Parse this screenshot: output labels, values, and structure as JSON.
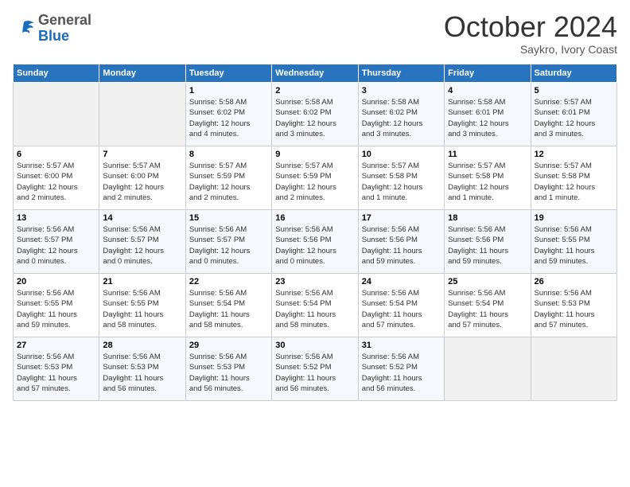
{
  "header": {
    "logo": {
      "general": "General",
      "blue": "Blue"
    },
    "title": "October 2024",
    "location": "Saykro, Ivory Coast"
  },
  "calendar": {
    "days_of_week": [
      "Sunday",
      "Monday",
      "Tuesday",
      "Wednesday",
      "Thursday",
      "Friday",
      "Saturday"
    ],
    "weeks": [
      [
        {
          "day": "",
          "info": ""
        },
        {
          "day": "",
          "info": ""
        },
        {
          "day": "1",
          "info": "Sunrise: 5:58 AM\nSunset: 6:02 PM\nDaylight: 12 hours\nand 4 minutes."
        },
        {
          "day": "2",
          "info": "Sunrise: 5:58 AM\nSunset: 6:02 PM\nDaylight: 12 hours\nand 3 minutes."
        },
        {
          "day": "3",
          "info": "Sunrise: 5:58 AM\nSunset: 6:02 PM\nDaylight: 12 hours\nand 3 minutes."
        },
        {
          "day": "4",
          "info": "Sunrise: 5:58 AM\nSunset: 6:01 PM\nDaylight: 12 hours\nand 3 minutes."
        },
        {
          "day": "5",
          "info": "Sunrise: 5:57 AM\nSunset: 6:01 PM\nDaylight: 12 hours\nand 3 minutes."
        }
      ],
      [
        {
          "day": "6",
          "info": "Sunrise: 5:57 AM\nSunset: 6:00 PM\nDaylight: 12 hours\nand 2 minutes."
        },
        {
          "day": "7",
          "info": "Sunrise: 5:57 AM\nSunset: 6:00 PM\nDaylight: 12 hours\nand 2 minutes."
        },
        {
          "day": "8",
          "info": "Sunrise: 5:57 AM\nSunset: 5:59 PM\nDaylight: 12 hours\nand 2 minutes."
        },
        {
          "day": "9",
          "info": "Sunrise: 5:57 AM\nSunset: 5:59 PM\nDaylight: 12 hours\nand 2 minutes."
        },
        {
          "day": "10",
          "info": "Sunrise: 5:57 AM\nSunset: 5:58 PM\nDaylight: 12 hours\nand 1 minute."
        },
        {
          "day": "11",
          "info": "Sunrise: 5:57 AM\nSunset: 5:58 PM\nDaylight: 12 hours\nand 1 minute."
        },
        {
          "day": "12",
          "info": "Sunrise: 5:57 AM\nSunset: 5:58 PM\nDaylight: 12 hours\nand 1 minute."
        }
      ],
      [
        {
          "day": "13",
          "info": "Sunrise: 5:56 AM\nSunset: 5:57 PM\nDaylight: 12 hours\nand 0 minutes."
        },
        {
          "day": "14",
          "info": "Sunrise: 5:56 AM\nSunset: 5:57 PM\nDaylight: 12 hours\nand 0 minutes."
        },
        {
          "day": "15",
          "info": "Sunrise: 5:56 AM\nSunset: 5:57 PM\nDaylight: 12 hours\nand 0 minutes."
        },
        {
          "day": "16",
          "info": "Sunrise: 5:56 AM\nSunset: 5:56 PM\nDaylight: 12 hours\nand 0 minutes."
        },
        {
          "day": "17",
          "info": "Sunrise: 5:56 AM\nSunset: 5:56 PM\nDaylight: 11 hours\nand 59 minutes."
        },
        {
          "day": "18",
          "info": "Sunrise: 5:56 AM\nSunset: 5:56 PM\nDaylight: 11 hours\nand 59 minutes."
        },
        {
          "day": "19",
          "info": "Sunrise: 5:56 AM\nSunset: 5:55 PM\nDaylight: 11 hours\nand 59 minutes."
        }
      ],
      [
        {
          "day": "20",
          "info": "Sunrise: 5:56 AM\nSunset: 5:55 PM\nDaylight: 11 hours\nand 59 minutes."
        },
        {
          "day": "21",
          "info": "Sunrise: 5:56 AM\nSunset: 5:55 PM\nDaylight: 11 hours\nand 58 minutes."
        },
        {
          "day": "22",
          "info": "Sunrise: 5:56 AM\nSunset: 5:54 PM\nDaylight: 11 hours\nand 58 minutes."
        },
        {
          "day": "23",
          "info": "Sunrise: 5:56 AM\nSunset: 5:54 PM\nDaylight: 11 hours\nand 58 minutes."
        },
        {
          "day": "24",
          "info": "Sunrise: 5:56 AM\nSunset: 5:54 PM\nDaylight: 11 hours\nand 57 minutes."
        },
        {
          "day": "25",
          "info": "Sunrise: 5:56 AM\nSunset: 5:54 PM\nDaylight: 11 hours\nand 57 minutes."
        },
        {
          "day": "26",
          "info": "Sunrise: 5:56 AM\nSunset: 5:53 PM\nDaylight: 11 hours\nand 57 minutes."
        }
      ],
      [
        {
          "day": "27",
          "info": "Sunrise: 5:56 AM\nSunset: 5:53 PM\nDaylight: 11 hours\nand 57 minutes."
        },
        {
          "day": "28",
          "info": "Sunrise: 5:56 AM\nSunset: 5:53 PM\nDaylight: 11 hours\nand 56 minutes."
        },
        {
          "day": "29",
          "info": "Sunrise: 5:56 AM\nSunset: 5:53 PM\nDaylight: 11 hours\nand 56 minutes."
        },
        {
          "day": "30",
          "info": "Sunrise: 5:56 AM\nSunset: 5:52 PM\nDaylight: 11 hours\nand 56 minutes."
        },
        {
          "day": "31",
          "info": "Sunrise: 5:56 AM\nSunset: 5:52 PM\nDaylight: 11 hours\nand 56 minutes."
        },
        {
          "day": "",
          "info": ""
        },
        {
          "day": "",
          "info": ""
        }
      ]
    ]
  }
}
